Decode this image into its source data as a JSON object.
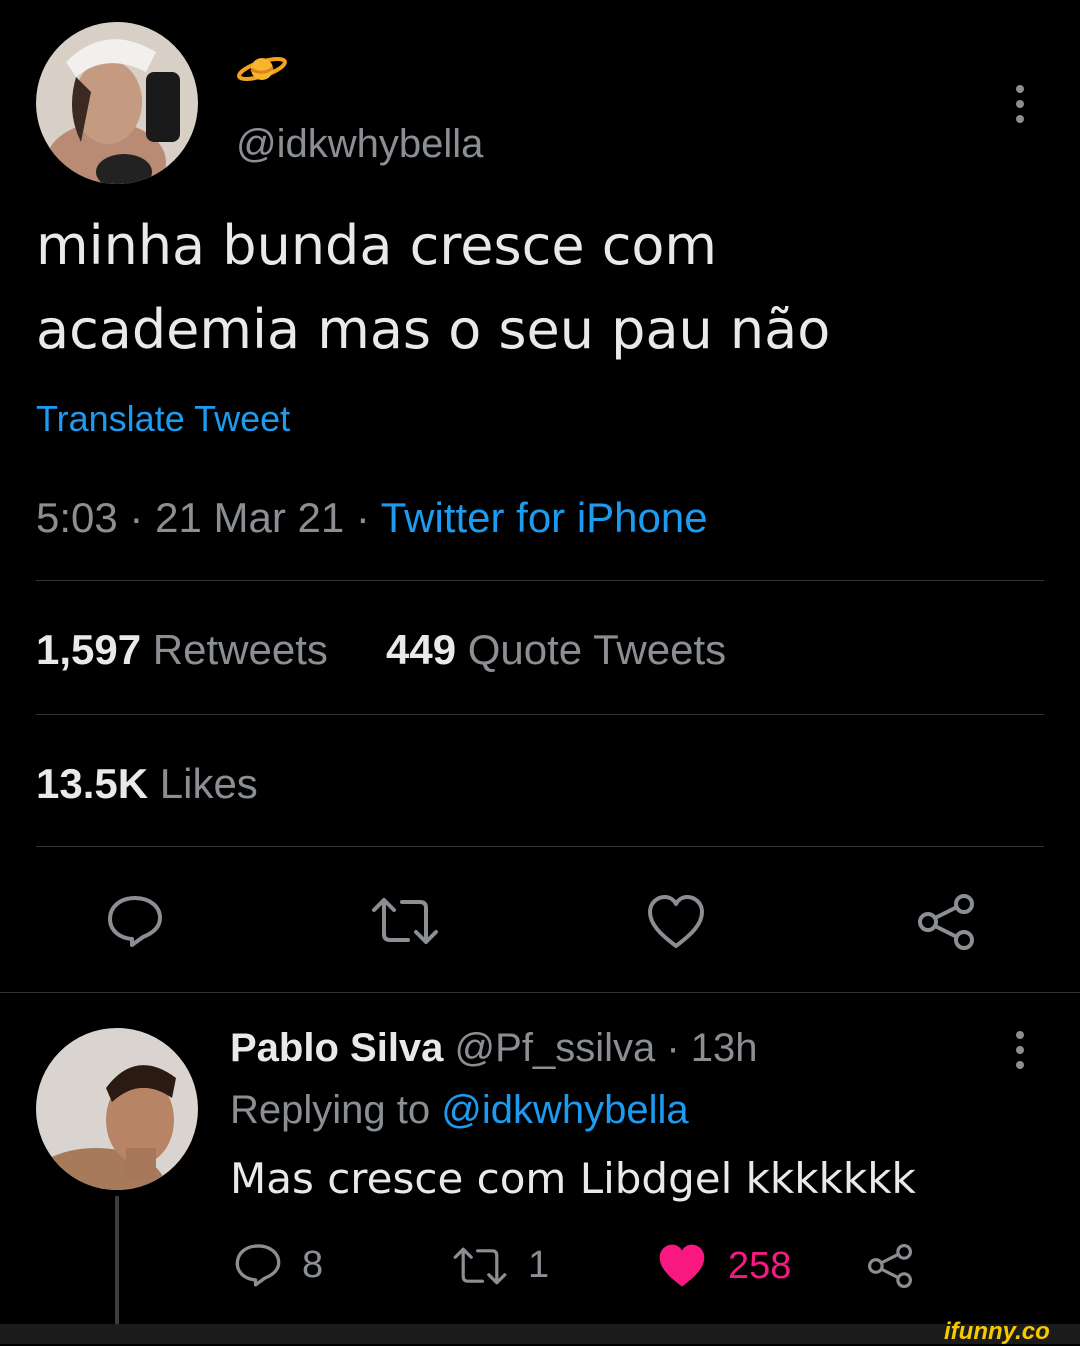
{
  "tweet": {
    "handle": "@idkwhybella",
    "text_line1": "minha bunda cresce com",
    "text_line2": "academia mas o seu pau não",
    "translate": "Translate Tweet",
    "time": "5:03",
    "date": "21 Mar 21",
    "sep": "·",
    "source": "Twitter for iPhone",
    "retweets_count": "1,597",
    "retweets_label": "Retweets",
    "quotes_count": "449",
    "quotes_label": "Quote Tweets",
    "likes_count": "13.5K",
    "likes_label": "Likes"
  },
  "reply": {
    "name": "Pablo Silva",
    "handle": "@Pf_ssilva",
    "sep": "·",
    "age": "13h",
    "replying_prefix": "Replying to",
    "replying_to": "@idkwhybella",
    "text": "Mas cresce com Libdgel kkkkkkk",
    "replies": "8",
    "retweets": "1",
    "likes": "258"
  },
  "watermark": "ifunny.co",
  "icons": {
    "planet": "planet-emoji-icon",
    "more": "more-vertical-icon",
    "reply": "reply-icon",
    "retweet": "retweet-icon",
    "like": "heart-icon",
    "share": "share-icon"
  },
  "colors": {
    "accent": "#1d9bf0",
    "like_active": "#f91880",
    "background": "#000000",
    "watermark": "#f6c900"
  }
}
